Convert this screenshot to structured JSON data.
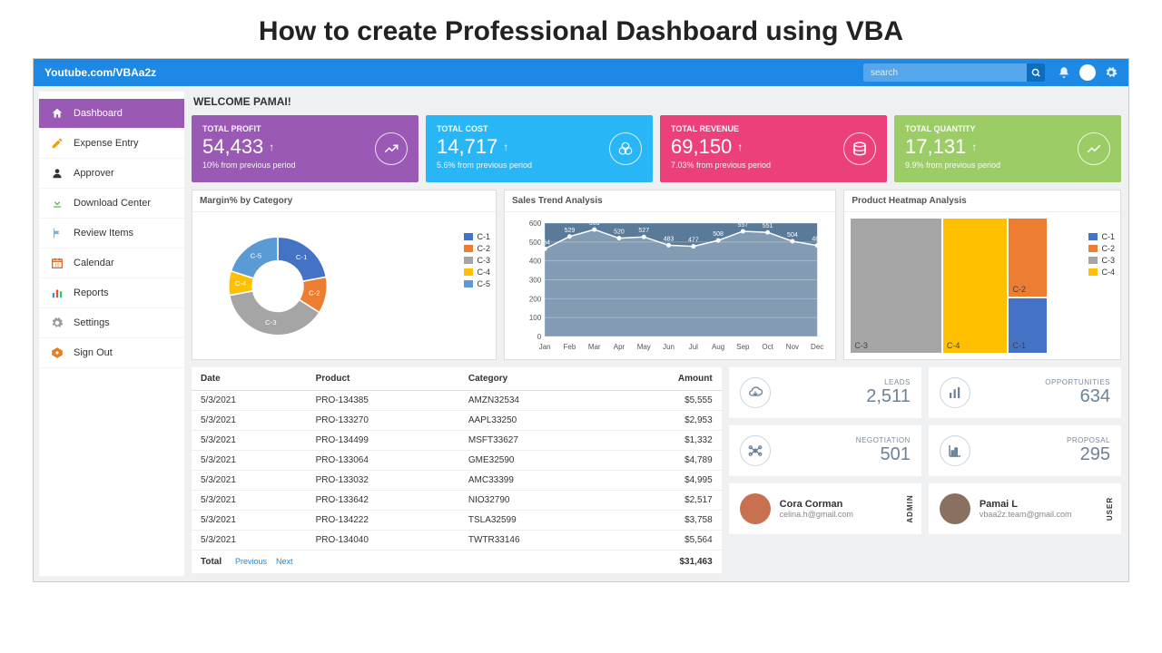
{
  "page_title": "How to create Professional Dashboard using VBA",
  "brand": "Youtube.com/VBAa2z",
  "search": {
    "placeholder": "search"
  },
  "welcome": "WELCOME PAMAI!",
  "sidebar": {
    "items": [
      {
        "label": "Dashboard",
        "icon": "home",
        "active": true
      },
      {
        "label": "Expense Entry",
        "icon": "pencil"
      },
      {
        "label": "Approver",
        "icon": "user"
      },
      {
        "label": "Download Center",
        "icon": "download"
      },
      {
        "label": "Review Items",
        "icon": "flag"
      },
      {
        "label": "Calendar",
        "icon": "calendar"
      },
      {
        "label": "Reports",
        "icon": "bars"
      },
      {
        "label": "Settings",
        "icon": "gear"
      },
      {
        "label": "Sign Out",
        "icon": "power"
      }
    ]
  },
  "kpis": [
    {
      "label": "TOTAL PROFIT",
      "value": "54,433",
      "trend": "↑",
      "sub": "10% from previous period",
      "color": "#9b59b6"
    },
    {
      "label": "TOTAL COST",
      "value": "14,717",
      "trend": "↑",
      "sub": "5.6% from previous period",
      "color": "#29b6f6"
    },
    {
      "label": "TOTAL REVENUE",
      "value": "69,150",
      "trend": "↑",
      "sub": "7.03% from previous period",
      "color": "#ec407a"
    },
    {
      "label": "TOTAL QUANTITY",
      "value": "17,131",
      "trend": "↑",
      "sub": "9.9% from previous period",
      "color": "#9ccc65"
    }
  ],
  "charts": {
    "margin": {
      "title": "Margin% by Category"
    },
    "sales": {
      "title": "Sales Trend Analysis"
    },
    "heatmap": {
      "title": "Product Heatmap Analysis"
    }
  },
  "chart_data": [
    {
      "type": "pie",
      "title": "Margin% by Category",
      "series": [
        {
          "name": "C-1",
          "value": 22,
          "color": "#4472c4"
        },
        {
          "name": "C-2",
          "value": 12,
          "color": "#ed7d31"
        },
        {
          "name": "C-3",
          "value": 38,
          "color": "#a5a5a5"
        },
        {
          "name": "C-4",
          "value": 8,
          "color": "#ffc000"
        },
        {
          "name": "C-5",
          "value": 20,
          "color": "#5b9bd5"
        }
      ]
    },
    {
      "type": "line",
      "title": "Sales Trend Analysis",
      "categories": [
        "Jan",
        "Feb",
        "Mar",
        "Apr",
        "May",
        "Jun",
        "Jul",
        "Aug",
        "Sep",
        "Oct",
        "Nov",
        "Dec"
      ],
      "values": [
        464,
        529,
        566,
        520,
        527,
        483,
        477,
        508,
        557,
        551,
        504,
        482
      ],
      "ylim": [
        0,
        600
      ],
      "yticks": [
        0,
        100,
        200,
        300,
        400,
        500,
        600
      ]
    },
    {
      "type": "heatmap",
      "title": "Product Heatmap Analysis",
      "series": [
        {
          "name": "C-1",
          "color": "#4472c4"
        },
        {
          "name": "C-2",
          "color": "#ed7d31"
        },
        {
          "name": "C-3",
          "color": "#a5a5a5"
        },
        {
          "name": "C-4",
          "color": "#ffc000"
        }
      ]
    }
  ],
  "table": {
    "headers": [
      "Date",
      "Product",
      "Category",
      "Amount"
    ],
    "rows": [
      {
        "date": "5/3/2021",
        "product": "PRO-134385",
        "category": "AMZN32534",
        "amount": "$5,555"
      },
      {
        "date": "5/3/2021",
        "product": "PRO-133270",
        "category": "AAPL33250",
        "amount": "$2,953"
      },
      {
        "date": "5/3/2021",
        "product": "PRO-134499",
        "category": "MSFT33627",
        "amount": "$1,332"
      },
      {
        "date": "5/3/2021",
        "product": "PRO-133064",
        "category": "GME32590",
        "amount": "$4,789"
      },
      {
        "date": "5/3/2021",
        "product": "PRO-133032",
        "category": "AMC33399",
        "amount": "$4,995"
      },
      {
        "date": "5/3/2021",
        "product": "PRO-133642",
        "category": "NIO32790",
        "amount": "$2,517"
      },
      {
        "date": "5/3/2021",
        "product": "PRO-134222",
        "category": "TSLA32599",
        "amount": "$3,758"
      },
      {
        "date": "5/3/2021",
        "product": "PRO-134040",
        "category": "TWTR33146",
        "amount": "$5,564"
      }
    ],
    "total_label": "Total",
    "total_value": "$31,463",
    "prev": "Previous",
    "next": "Next"
  },
  "stats": [
    {
      "label": "LEADS",
      "value": "2,511",
      "icon": "cloud"
    },
    {
      "label": "OPPORTUNITIES",
      "value": "634",
      "icon": "bars"
    },
    {
      "label": "NEGOTIATION",
      "value": "501",
      "icon": "nodes"
    },
    {
      "label": "PROPOSAL",
      "value": "295",
      "icon": "chart"
    }
  ],
  "users": [
    {
      "name": "Cora Corman",
      "email": "celina.h@gmail.com",
      "role": "ADMIN",
      "avatar": "#c97050"
    },
    {
      "name": "Pamai L",
      "email": "vbaa2z.team@gmail.com",
      "role": "USER",
      "avatar": "#8a7060"
    }
  ]
}
